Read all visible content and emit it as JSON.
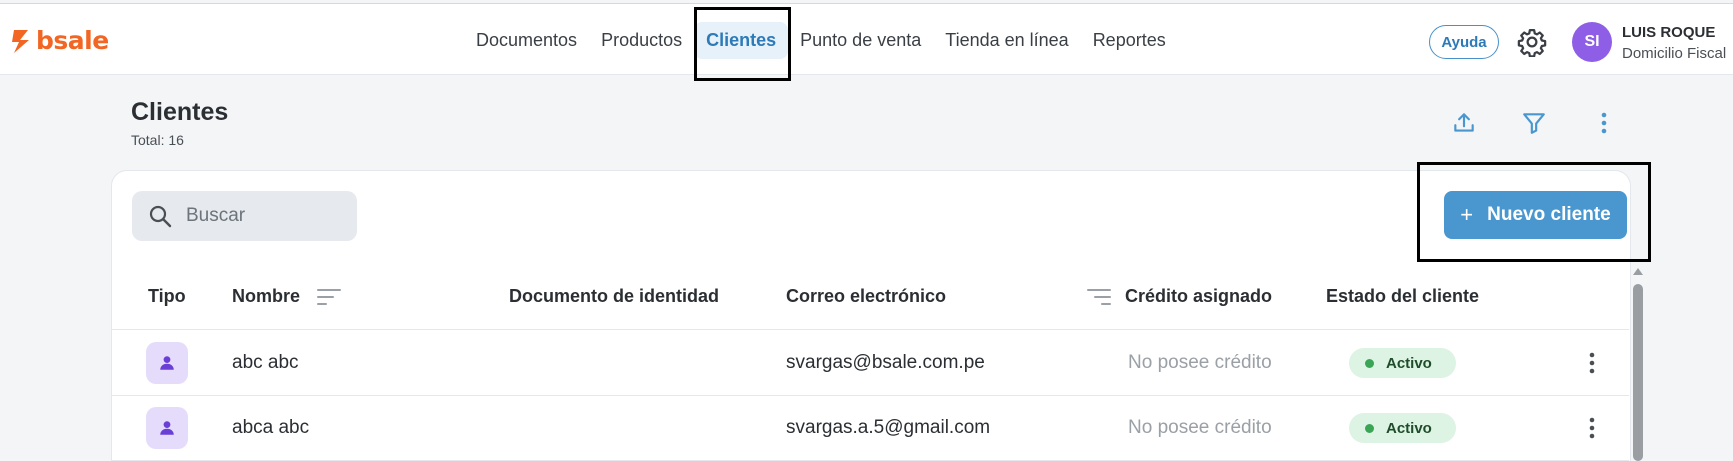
{
  "app": {
    "logo_text": "bsale"
  },
  "nav": {
    "items": [
      {
        "label": "Documentos"
      },
      {
        "label": "Productos"
      },
      {
        "label": "Clientes",
        "active": true
      },
      {
        "label": "Punto de venta"
      },
      {
        "label": "Tienda en línea"
      },
      {
        "label": "Reportes"
      }
    ]
  },
  "header": {
    "help_label": "Ayuda",
    "user_initials": "SI",
    "user_name": "LUIS ROQUE",
    "user_subtitle": "Domicilio Fiscal"
  },
  "page": {
    "title": "Clientes",
    "total": "Total: 16"
  },
  "toolbar": {
    "search_placeholder": "Buscar",
    "new_button_label": "Nuevo cliente",
    "new_button_icon": "+"
  },
  "table": {
    "columns": {
      "tipo": "Tipo",
      "nombre": "Nombre",
      "documento": "Documento de identidad",
      "correo": "Correo electrónico",
      "credito": "Crédito asignado",
      "estado": "Estado del cliente"
    },
    "rows": [
      {
        "nombre": "abc abc",
        "documento": "",
        "correo": "svargas@bsale.com.pe",
        "credito": "No posee crédito",
        "estado": "Activo"
      },
      {
        "nombre": "abca abc",
        "documento": "",
        "correo": "svargas.a.5@gmail.com",
        "credito": "No posee crédito",
        "estado": "Activo"
      }
    ]
  },
  "colors": {
    "brand": "#f26522",
    "accent": "#4a97cf",
    "active_status": "#3aa655",
    "avatar": "#8e5ee6"
  },
  "icons": [
    "bsale-logo-icon",
    "gear-icon",
    "upload-icon",
    "filter-icon",
    "more-vertical-icon",
    "search-icon",
    "sort-icon",
    "person-icon"
  ]
}
